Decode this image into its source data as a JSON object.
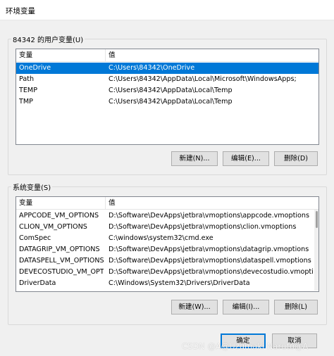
{
  "window": {
    "title": "环境变量"
  },
  "user_vars": {
    "group_label": "84342 的用户变量(U)",
    "columns": [
      "变量",
      "值"
    ],
    "rows": [
      {
        "name": "OneDrive",
        "value": "C:\\Users\\84342\\OneDrive",
        "selected": true
      },
      {
        "name": "Path",
        "value": "C:\\Users\\84342\\AppData\\Local\\Microsoft\\WindowsApps;"
      },
      {
        "name": "TEMP",
        "value": "C:\\Users\\84342\\AppData\\Local\\Temp"
      },
      {
        "name": "TMP",
        "value": "C:\\Users\\84342\\AppData\\Local\\Temp"
      }
    ],
    "buttons": {
      "new": "新建(N)...",
      "edit": "编辑(E)...",
      "delete": "删除(D)"
    }
  },
  "system_vars": {
    "group_label": "系统变量(S)",
    "columns": [
      "变量",
      "值"
    ],
    "rows": [
      {
        "name": "APPCODE_VM_OPTIONS",
        "value": "D:\\Software\\DevApps\\jetbra\\vmoptions\\appcode.vmoptions"
      },
      {
        "name": "CLION_VM_OPTIONS",
        "value": "D:\\Software\\DevApps\\jetbra\\vmoptions\\clion.vmoptions"
      },
      {
        "name": "ComSpec",
        "value": "C:\\windows\\system32\\cmd.exe"
      },
      {
        "name": "DATAGRIP_VM_OPTIONS",
        "value": "D:\\Software\\DevApps\\jetbra\\vmoptions\\datagrip.vmoptions"
      },
      {
        "name": "DATASPELL_VM_OPTIONS",
        "value": "D:\\Software\\DevApps\\jetbra\\vmoptions\\dataspell.vmoptions"
      },
      {
        "name": "DEVECOSTUDIO_VM_OPT...",
        "value": "D:\\Software\\DevApps\\jetbra\\vmoptions\\devecostudio.vmoptions"
      },
      {
        "name": "DriverData",
        "value": "C:\\Windows\\System32\\Drivers\\DriverData"
      }
    ],
    "buttons": {
      "new": "新建(W)...",
      "edit": "编辑(I)...",
      "delete": "删除(L)"
    }
  },
  "footer": {
    "ok": "确定",
    "cancel": "取消"
  },
  "watermark": "CSDN @A@Uzumaki Naruto@A",
  "colors": {
    "selection": "#0078d7",
    "background": "#f0f0f0"
  }
}
